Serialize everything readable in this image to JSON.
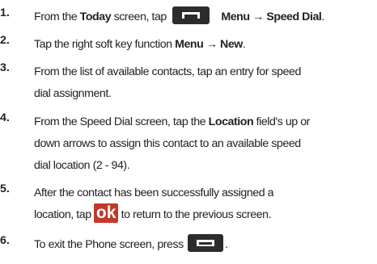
{
  "steps": [
    {
      "number": "1.",
      "t1": "From the ",
      "b1": "Today",
      "t2": " screen, tap ",
      "b2": "Menu → Speed Dial",
      "t3": "."
    },
    {
      "number": "2.",
      "t1": "Tap the right soft key function ",
      "b1": "Menu → New",
      "t2": "."
    },
    {
      "number": "3.",
      "line1": "From the list of available contacts, tap an entry for speed",
      "line2": "dial assignment."
    },
    {
      "number": "4.",
      "t1": "From the Speed Dial screen, tap the ",
      "b1": "Location",
      "t2": " field's up or",
      "line2": "down arrows to assign this contact to an available speed",
      "line3": "dial location (2 - 94)."
    },
    {
      "number": "5.",
      "line1": "After the contact has been successfully assigned a",
      "t1": "location, tap ",
      "ok_label": "ok",
      "t2": " to return to the previous screen."
    },
    {
      "number": "6.",
      "t1": "To exit the Phone screen, press ",
      "t2": "."
    }
  ],
  "icons": {
    "menu_key": "menu-softkey-icon",
    "ok_key": "ok-key-icon",
    "ok_color": "#c0392b",
    "key_color": "#2c2c2c"
  }
}
